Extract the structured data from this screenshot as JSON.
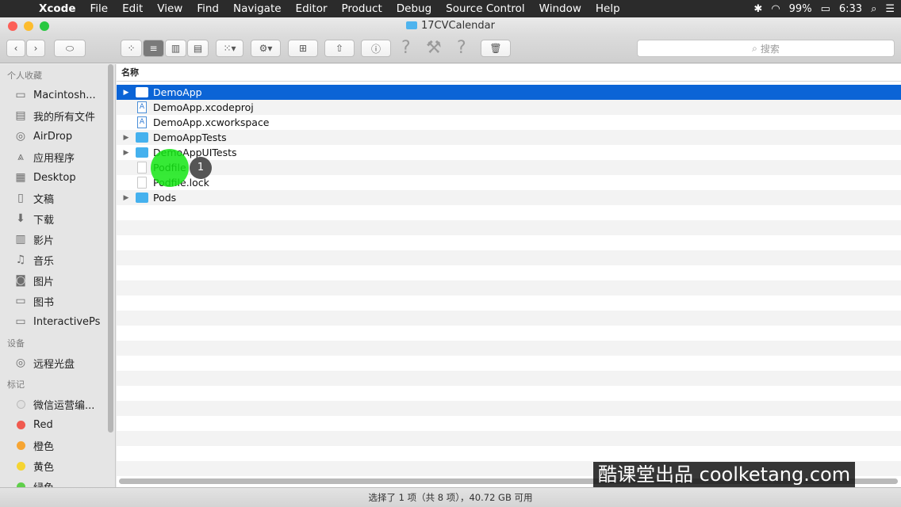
{
  "menubar": {
    "app": "Xcode",
    "items": [
      "File",
      "Edit",
      "View",
      "Find",
      "Navigate",
      "Editor",
      "Product",
      "Debug",
      "Source Control",
      "Window",
      "Help"
    ],
    "battery": "99%",
    "time": "6:33"
  },
  "window": {
    "title": "17CVCalendar"
  },
  "toolbar": {
    "search_placeholder": "搜索"
  },
  "sidebar": {
    "favorites_header": "个人收藏",
    "favorites": [
      "Macintosh...",
      "我的所有文件",
      "AirDrop",
      "应用程序",
      "Desktop",
      "文稿",
      "下载",
      "影片",
      "音乐",
      "图片",
      "图书",
      "InteractivePs"
    ],
    "devices_header": "设备",
    "devices": [
      "远程光盘"
    ],
    "tags_header": "标记",
    "tags": [
      {
        "label": "微信运营编...",
        "color": "#e0e0e0"
      },
      {
        "label": "Red",
        "color": "#f05a4f"
      },
      {
        "label": "橙色",
        "color": "#f6a533"
      },
      {
        "label": "黄色",
        "color": "#f5d432"
      },
      {
        "label": "绿色",
        "color": "#5fcf4a"
      }
    ]
  },
  "content": {
    "column_header": "名称",
    "files": [
      {
        "name": "DemoApp",
        "kind": "folder",
        "expandable": true,
        "selected": true
      },
      {
        "name": "DemoApp.xcodeproj",
        "kind": "xcode",
        "expandable": false,
        "selected": false
      },
      {
        "name": "DemoApp.xcworkspace",
        "kind": "xcode",
        "expandable": false,
        "selected": false
      },
      {
        "name": "DemoAppTests",
        "kind": "folder",
        "expandable": true,
        "selected": false
      },
      {
        "name": "DemoAppUITests",
        "kind": "folder",
        "expandable": true,
        "selected": false
      },
      {
        "name": "Podfile",
        "kind": "doc",
        "expandable": false,
        "selected": false
      },
      {
        "name": "Podfile.lock",
        "kind": "doc",
        "expandable": false,
        "selected": false
      },
      {
        "name": "Pods",
        "kind": "folder",
        "expandable": true,
        "selected": false
      }
    ]
  },
  "status": {
    "text": "选择了 1 项（共 8 项），40.72 GB 可用"
  },
  "overlay": {
    "step": "1",
    "watermark": "酷课堂出品 coolketang.com"
  }
}
